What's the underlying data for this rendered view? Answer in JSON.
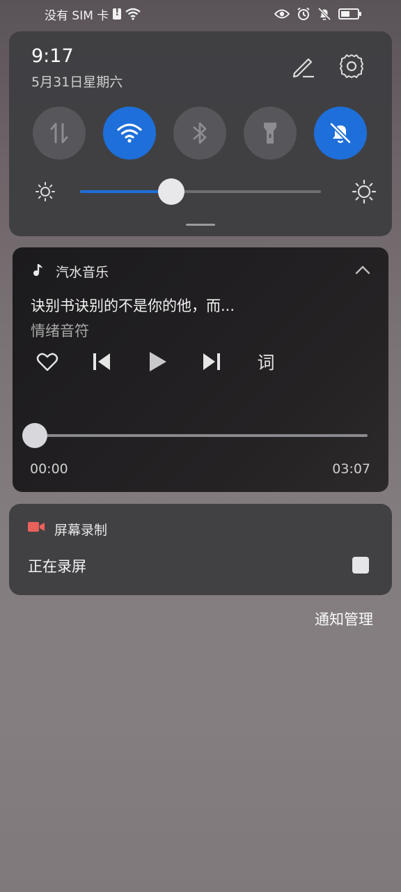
{
  "status_bar": {
    "carrier": "没有 SIM 卡",
    "icons_left": [
      "sim-alert-icon",
      "wifi-icon"
    ],
    "icons_right": [
      "eye-icon",
      "alarm-icon",
      "bell-off-icon",
      "battery-icon"
    ],
    "battery_level": 0.4
  },
  "quick_settings": {
    "time": "9:17",
    "date": "5月31日星期六",
    "tiles": [
      {
        "name": "mobile-data",
        "icon": "data-transfer-icon",
        "active": false
      },
      {
        "name": "wifi",
        "icon": "wifi-icon",
        "active": true
      },
      {
        "name": "bluetooth",
        "icon": "bluetooth-icon",
        "active": false
      },
      {
        "name": "flashlight",
        "icon": "flashlight-icon",
        "active": false
      },
      {
        "name": "do-not-disturb",
        "icon": "bell-off-icon",
        "active": true
      }
    ],
    "brightness": 0.38,
    "accent_color": "#1e6fd9"
  },
  "music": {
    "app_name": "汽水音乐",
    "title": "诀别书诀别的不是你的他，而...",
    "artist": "情绪音符",
    "lyrics_label": "词",
    "time_current": "00:00",
    "time_total": "03:07",
    "progress": 0.0
  },
  "recording": {
    "app_name": "屏幕录制",
    "status": "正在录屏",
    "icon_color": "#e8615a"
  },
  "footer": {
    "manage_label": "通知管理"
  }
}
